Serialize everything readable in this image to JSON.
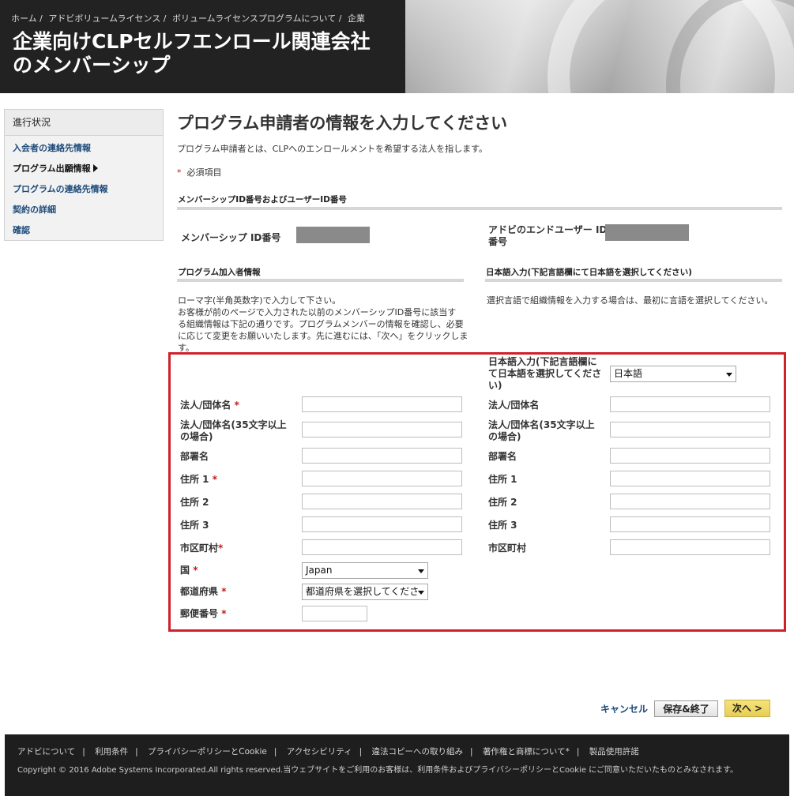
{
  "header": {
    "breadcrumbs": [
      "ホーム /",
      "アドビボリュームライセンス /",
      "ボリュームライセンスプログラムについて /",
      "企業"
    ],
    "title_line1": "企業向けCLPセルフエンロール関連会社",
    "title_line2": "のメンバーシップ"
  },
  "sidebar": {
    "heading": "進行状況",
    "items": [
      {
        "label": "入会者の連絡先情報"
      },
      {
        "label": "プログラム出願情報"
      },
      {
        "label": "プログラムの連絡先情報"
      },
      {
        "label": "契約の詳細"
      },
      {
        "label": "確認"
      }
    ]
  },
  "main": {
    "title": "プログラム申請者の情報を入力してください",
    "description": "プログラム申請者とは、CLPへのエンロールメントを希望する法人を指します。",
    "required_star": "*",
    "required_note": "必須項目",
    "id_section": {
      "heading": "メンバーシップID番号およびユーザーID番号",
      "membership_label": "メンバーシップ ID番号",
      "enduser_label_1": "アドビのエンドユーザー ID",
      "enduser_label_2": "番号"
    },
    "left_section": {
      "heading": "プログラム加入者情報",
      "note_1": "ローマ字(半角英数字)で入力して下さい。",
      "note_2": "お客様が前のページで入力された以前のメンバーシップID番号に該当す",
      "note_3": "る組織情報は下記の通りです。プログラムメンバーの情報を確認し、必要",
      "note_4": "に応じて変更をお願いいたします。先に進むには、「次へ」をクリックしま",
      "note_5": "す。"
    },
    "right_section": {
      "heading": "日本語入力(下記言語欄にて日本語を選択してください)",
      "note": "選択言語で組織情報を入力する場合は、最初に言語を選択してください。",
      "lang_label_1": "日本語入力(下記言語欄に",
      "lang_label_2": "て日本語を選択してくださ",
      "lang_label_3": "い)",
      "lang_value": "日本語"
    },
    "left_fields": {
      "company": "法人/団体名",
      "company_long_1": "法人/団体名(35文字以上",
      "company_long_2": "の場合)",
      "department": "部署名",
      "address1": "住所 1",
      "address2": "住所 2",
      "address3": "住所 3",
      "city": "市区町村",
      "country": "国",
      "country_value": "Japan",
      "prefecture": "都道府県",
      "prefecture_value": "都道府県を選択してくださ",
      "postal": "郵便番号"
    },
    "right_fields": {
      "company": "法人/団体名",
      "company_long_1": "法人/団体名(35文字以上",
      "company_long_2": "の場合)",
      "department": "部署名",
      "address1": "住所 1",
      "address2": "住所 2",
      "address3": "住所 3",
      "city": "市区町村"
    }
  },
  "actions": {
    "cancel": "キャンセル",
    "save": "保存&終了",
    "next": "次へ >"
  },
  "footer": {
    "links": [
      "アドビについて",
      "利用条件",
      "プライバシーポリシーとCookie",
      "アクセシビリティ",
      "違法コピーへの取り組み",
      "著作権と商標について*",
      "製品使用許諾"
    ],
    "copyright": "Copyright © 2016 Adobe Systems Incorporated.All rights reserved.当ウェブサイトをご利用のお客様は、利用条件およびプライバシーポリシーとCookie にご同意いただいたものとみなされます。"
  },
  "colors": {
    "header_dark": "#222222",
    "link_blue": "#1d4a7a",
    "required_red": "#c41b1b",
    "highlight_red": "#d0202a",
    "next_button_yellow": "#ecd660"
  }
}
